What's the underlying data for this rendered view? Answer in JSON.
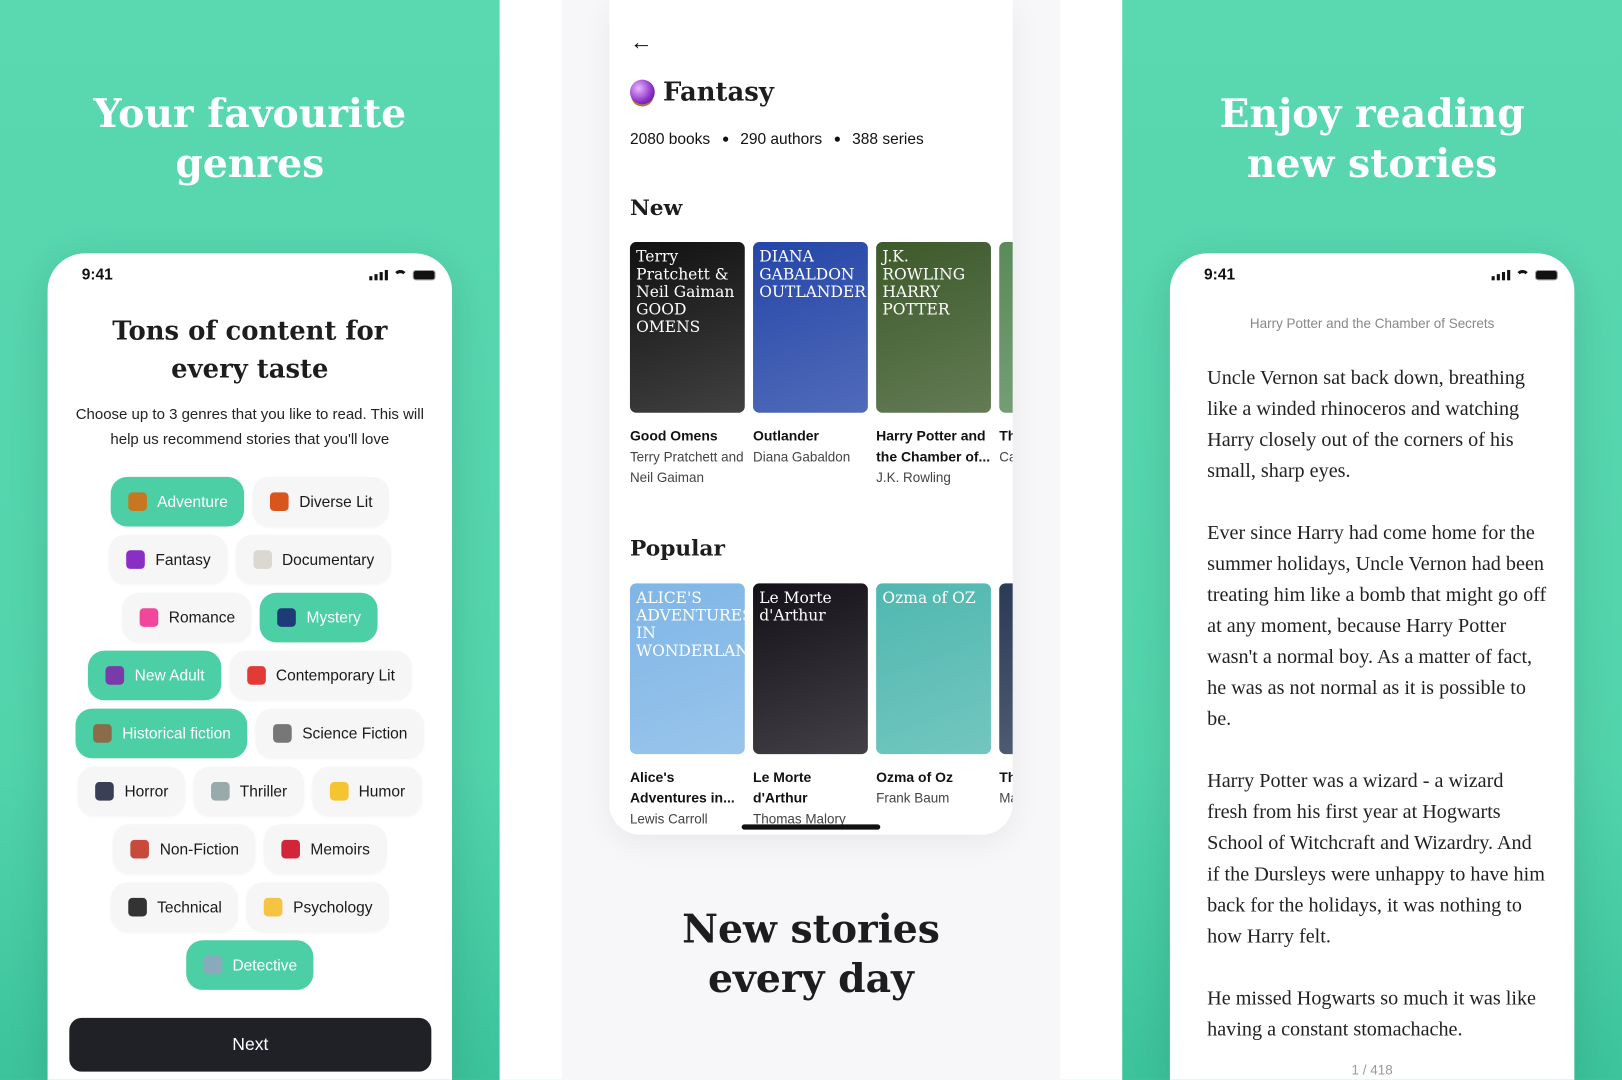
{
  "left": {
    "headline": "Your favourite genres",
    "status_time": "9:41",
    "title": "Tons of content for every taste",
    "subtitle": "Choose up to 3 genres that you like to read. This will help us recommend stories that you'll love",
    "genre_rows": [
      [
        {
          "label": "Adventure",
          "icon": "sailboat-icon",
          "color": "#c7771f",
          "selected": true
        },
        {
          "label": "Diverse Lit",
          "icon": "fireworks-icon",
          "color": "#d8551c",
          "selected": false
        }
      ],
      [
        {
          "label": "Fantasy",
          "icon": "crystal-ball-icon",
          "color": "#8a2fc4",
          "selected": false
        },
        {
          "label": "Documentary",
          "icon": "scroll-icon",
          "color": "#d9d9d2",
          "selected": false
        }
      ],
      [
        {
          "label": "Romance",
          "icon": "two-hearts-icon",
          "color": "#f0479a",
          "selected": false
        },
        {
          "label": "Mystery",
          "icon": "milky-way-icon",
          "color": "#1f3b77",
          "selected": true
        }
      ],
      [
        {
          "label": "New Adult",
          "icon": "dancer-icon",
          "color": "#7a3aa8",
          "selected": true
        },
        {
          "label": "Contemporary Lit",
          "icon": "popcorn-icon",
          "color": "#e03b35",
          "selected": false
        }
      ],
      [
        {
          "label": "Historical fiction",
          "icon": "castle-icon",
          "color": "#8c6b4a",
          "selected": true
        },
        {
          "label": "Science Fiction",
          "icon": "telescope-icon",
          "color": "#777",
          "selected": false
        }
      ],
      [
        {
          "label": "Horror",
          "icon": "new-moon-icon",
          "color": "#3b3f55",
          "selected": false
        },
        {
          "label": "Thriller",
          "icon": "knife-icon",
          "color": "#9aa",
          "selected": false
        },
        {
          "label": "Humor",
          "icon": "rofl-icon",
          "color": "#f5c431",
          "selected": false
        }
      ],
      [
        {
          "label": "Non-Fiction",
          "icon": "rocket-icon",
          "color": "#c84a3a",
          "selected": false
        },
        {
          "label": "Memoirs",
          "icon": "lips-icon",
          "color": "#d1263a",
          "selected": false
        }
      ],
      [
        {
          "label": "Technical",
          "icon": "laptop-icon",
          "color": "#333",
          "selected": false
        },
        {
          "label": "Psychology",
          "icon": "light-bulb-icon",
          "color": "#f6c343",
          "selected": false
        }
      ],
      [
        {
          "label": "Detective",
          "icon": "magnifier-icon",
          "color": "#8ab",
          "selected": true
        }
      ]
    ],
    "next_label": "Next"
  },
  "middle": {
    "back_icon": "arrow-left-icon",
    "genre_icon": "crystal-ball-icon",
    "genre": "Fantasy",
    "stats": [
      "2080 books",
      "290 authors",
      "388 series"
    ],
    "new_title": "New",
    "new_books": [
      {
        "title": "Good Omens",
        "author": "Terry Pratchett and Neil Gaiman",
        "cover_text": "Terry Pratchett & Neil Gaiman GOOD OMENS",
        "cover_color": "#111111"
      },
      {
        "title": "Outlander",
        "author": "Diana Gabaldon",
        "cover_text": "DIANA GABALDON OUTLANDER",
        "cover_color": "#2546a8"
      },
      {
        "title": "Harry Potter and the Chamber of...",
        "author": "J.K. Rowling",
        "cover_text": "J.K. ROWLING HARRY POTTER",
        "cover_color": "#3d5a2a"
      },
      {
        "title": "Th",
        "author": "Ca",
        "cover_text": "",
        "cover_color": "#5a8a5a"
      }
    ],
    "popular_title": "Popular",
    "popular_books": [
      {
        "title": "Alice's Adventures in...",
        "author": "Lewis Carroll",
        "cover_text": "ALICE'S ADVENTURES IN WONDERLAND",
        "cover_color": "#7fb6e6"
      },
      {
        "title": "Le Morte d'Arthur",
        "author": "Thomas Malory",
        "cover_text": "Le Morte d'Arthur",
        "cover_color": "#141018"
      },
      {
        "title": "Ozma of Oz",
        "author": "Frank Baum",
        "cover_text": "Ozma of OZ",
        "cover_color": "#4fb8b0"
      },
      {
        "title": "Th",
        "author": "Ma",
        "cover_text": "",
        "cover_color": "#2b3a55"
      }
    ],
    "headline": "New stories every day"
  },
  "right": {
    "headline": "Enjoy reading new stories",
    "status_time": "9:41",
    "book_title": "Harry Potter and the Chamber of Secrets",
    "paragraphs": [
      "Uncle Vernon sat back down, breathing like a winded rhinoceros and watching Harry closely out of the corners of his small, sharp eyes.",
      "Ever since Harry had come home for the summer holidays, Uncle Vernon had been treating him like a bomb that might go off at any moment, because Harry Potter wasn't a normal boy. As a matter of fact, he was as not normal as it is possible to be.",
      "Harry Potter was a wizard - a wizard fresh from his first year at Hogwarts School of Witchcraft and Wizardry. And if the Dursleys were unhappy to have him back for the holidays, it was nothing to how Harry felt.",
      "He missed Hogwarts so much it was like having a constant stomachache."
    ],
    "page_indicator": "1 / 418"
  },
  "colors": {
    "accent": "#4dcfa6",
    "background": "#5ad8b0",
    "button": "#1f2126"
  }
}
